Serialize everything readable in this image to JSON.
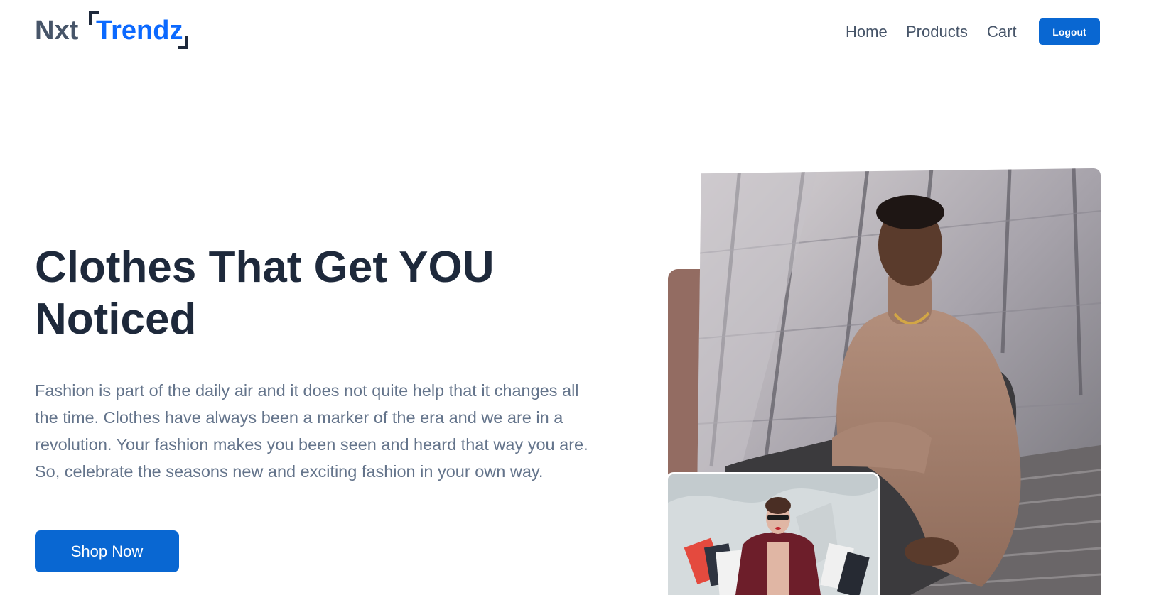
{
  "header": {
    "logo": {
      "part1": "Nxt",
      "part2": "Trendz"
    },
    "nav": [
      {
        "label": "Home"
      },
      {
        "label": "Products"
      },
      {
        "label": "Cart"
      }
    ],
    "logout_label": "Logout"
  },
  "hero": {
    "heading_line1": "Clothes That Get YOU",
    "heading_line2": "Noticed",
    "description": "Fashion is part of the daily air and it does not quite help that it changes all the time. Clothes have always been a marker of the era and we are in a revolution. Your fashion makes you been seen and heard that way you are. So, celebrate the seasons new and exciting fashion in your own way.",
    "cta_label": "Shop Now"
  },
  "colors": {
    "brand_blue": "#0b69ff",
    "button_blue": "#0967d2",
    "heading": "#1e293b",
    "body_text": "#64748b",
    "accent_brown": "#936c62"
  }
}
